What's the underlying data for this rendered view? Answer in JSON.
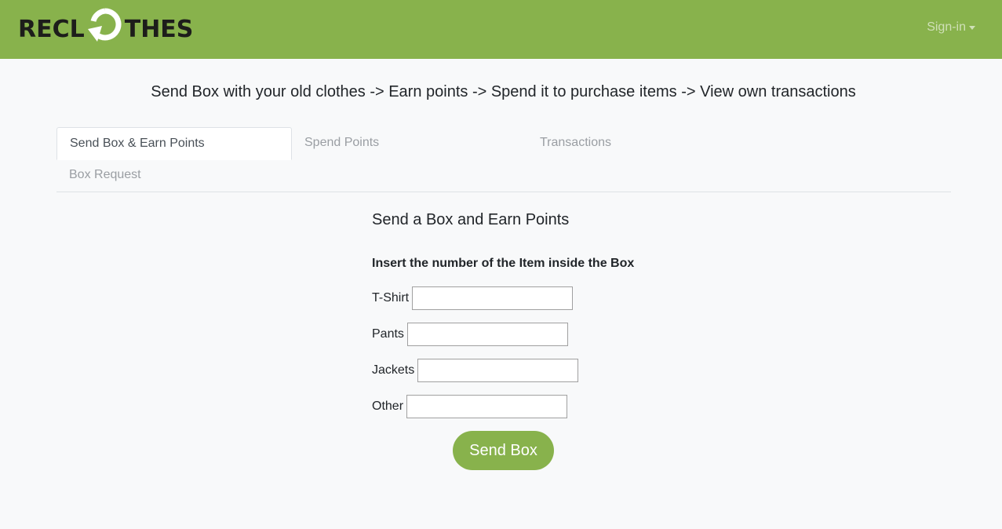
{
  "brand": {
    "logo_left": "RECL",
    "logo_right": "THES",
    "accent_color": "#88b24c",
    "logo_icon": "recycle-arrow-icon"
  },
  "nav": {
    "signin_label": "Sign-in",
    "signin_icon": "caret-down-icon"
  },
  "tagline": "Send Box with your old clothes -> Earn points -> Spend it to purchase items -> View own transactions",
  "tabs": [
    {
      "label": "Send Box & Earn Points",
      "active": true
    },
    {
      "label": "Spend Points",
      "active": false
    },
    {
      "label": "Transactions",
      "active": false
    },
    {
      "label": "Box Request",
      "active": false
    }
  ],
  "form": {
    "title": "Send a Box and Earn Points",
    "instruction": "Insert the number of the Item inside the Box",
    "fields": [
      {
        "label": "T-Shirt",
        "value": ""
      },
      {
        "label": "Pants",
        "value": ""
      },
      {
        "label": "Jackets",
        "value": ""
      },
      {
        "label": "Other",
        "value": ""
      }
    ],
    "submit_label": "Send Box"
  }
}
